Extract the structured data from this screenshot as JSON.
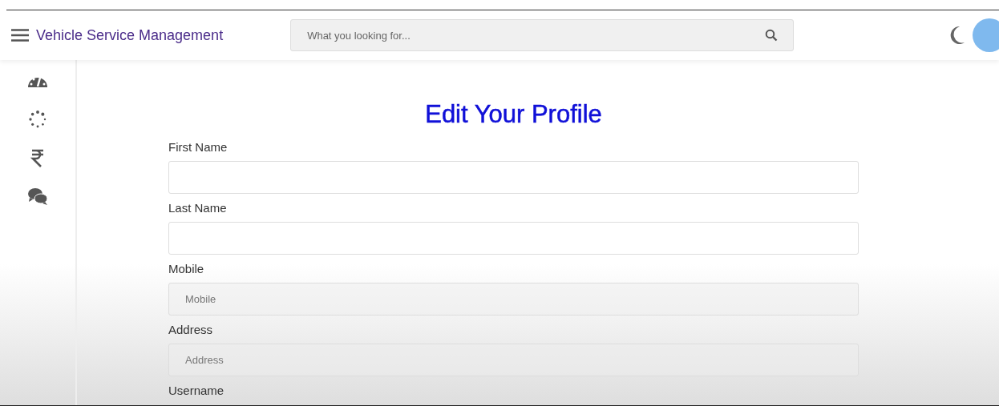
{
  "header": {
    "title": "Vehicle Service Management",
    "search": {
      "placeholder": "What you looking for..."
    }
  },
  "sidebar": {
    "items": [
      {
        "kind": "dashboard"
      },
      {
        "kind": "spinner"
      },
      {
        "kind": "rupee"
      },
      {
        "kind": "chat"
      }
    ]
  },
  "form": {
    "title": "Edit Your Profile",
    "fields": [
      {
        "kind": "input",
        "label": "First Name"
      },
      {
        "kind": "input",
        "label": "Last Name"
      },
      {
        "kind": "input",
        "label": "Mobile",
        "placeholder": "Mobile"
      },
      {
        "kind": "input",
        "label": "Address",
        "placeholder": "Address"
      },
      {
        "kind": "label_only",
        "label": "Username"
      }
    ]
  }
}
